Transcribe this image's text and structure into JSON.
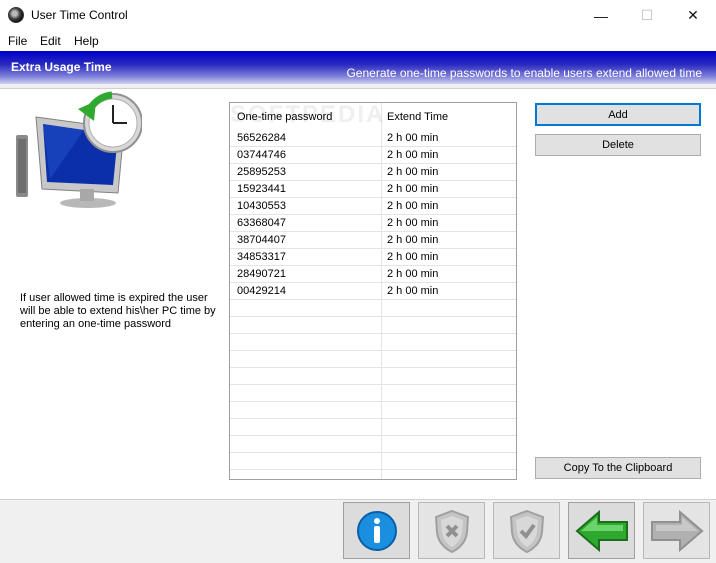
{
  "window": {
    "title": "User Time Control",
    "minimize": "—",
    "maximize": "☐",
    "close": "✕"
  },
  "menu": [
    "File",
    "Edit",
    "Help"
  ],
  "banner": {
    "title": "Extra Usage Time",
    "subtitle": "Generate one-time passwords to enable users extend allowed time"
  },
  "info": "If user allowed time is expired the user will be able to extend his\\her PC time by entering an one-time password",
  "watermark": "SOFTPEDIA",
  "table": {
    "headers": [
      "One-time password",
      "Extend Time"
    ],
    "rows": [
      [
        "56526284",
        "2 h 00 min"
      ],
      [
        "03744746",
        "2 h 00 min"
      ],
      [
        "25895253",
        "2 h 00 min"
      ],
      [
        "15923441",
        "2 h 00 min"
      ],
      [
        "10430553",
        "2 h 00 min"
      ],
      [
        "63368047",
        "2 h 00 min"
      ],
      [
        "38704407",
        "2 h 00 min"
      ],
      [
        "34853317",
        "2 h 00 min"
      ],
      [
        "28490721",
        "2 h 00 min"
      ],
      [
        "00429214",
        "2 h 00 min"
      ]
    ]
  },
  "buttons": {
    "add": "Add",
    "delete": "Delete",
    "copy": "Copy To the Clipboard"
  },
  "toolbar": {
    "icons": [
      "info-icon",
      "shield-x-icon",
      "shield-check-icon",
      "back-arrow-icon",
      "forward-arrow-icon"
    ]
  },
  "colors": {
    "banner": "#0000c8",
    "accent": "#0078d7",
    "info": "#1a8fe0",
    "green": "#2fa82f",
    "disabled": "#b0b0b0"
  }
}
